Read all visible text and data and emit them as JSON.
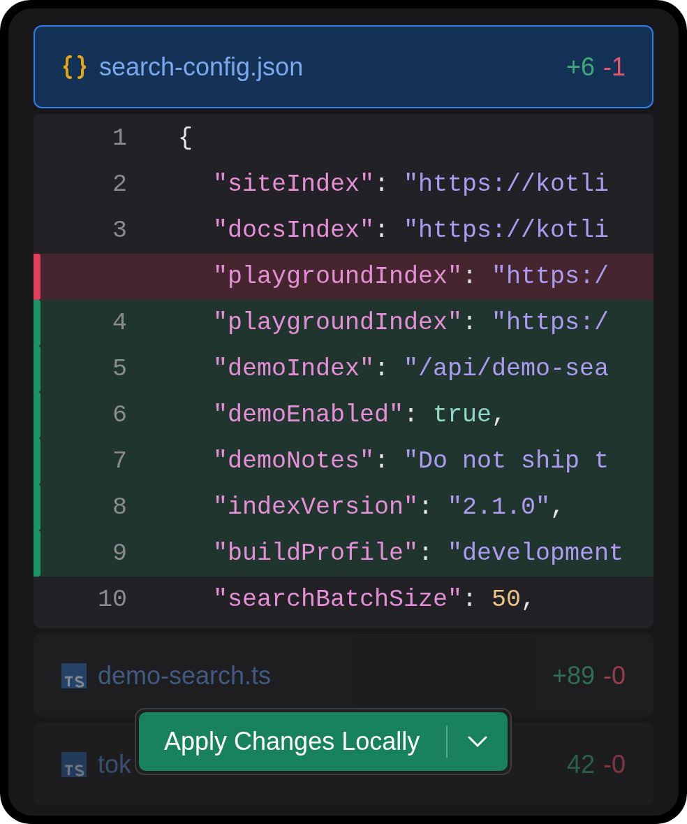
{
  "files": [
    {
      "name": "search-config.json",
      "kind": "json",
      "selected": true,
      "added": "+6",
      "removed": "-1",
      "lines": [
        {
          "number": "1",
          "kind": "context",
          "tokens": [
            {
              "kind": "punct",
              "text": "{"
            }
          ]
        },
        {
          "number": "2",
          "kind": "context",
          "tokens": [
            {
              "kind": "key",
              "text": "\"siteIndex\""
            },
            {
              "kind": "punct",
              "text": ": "
            },
            {
              "kind": "string",
              "text": "\"https://kotli"
            }
          ]
        },
        {
          "number": "3",
          "kind": "context",
          "tokens": [
            {
              "kind": "key",
              "text": "\"docsIndex\""
            },
            {
              "kind": "punct",
              "text": ": "
            },
            {
              "kind": "string",
              "text": "\"https://kotli"
            }
          ]
        },
        {
          "kind": "removed",
          "tokens": [
            {
              "kind": "key",
              "text": "\"playgroundIndex\""
            },
            {
              "kind": "punct",
              "text": ": "
            },
            {
              "kind": "string",
              "text": "\"https:/"
            }
          ]
        },
        {
          "number": "4",
          "kind": "added",
          "tokens": [
            {
              "kind": "key",
              "text": "\"playgroundIndex\""
            },
            {
              "kind": "punct",
              "text": ": "
            },
            {
              "kind": "string",
              "text": "\"https:/"
            }
          ]
        },
        {
          "number": "5",
          "kind": "added",
          "tokens": [
            {
              "kind": "key",
              "text": "\"demoIndex\""
            },
            {
              "kind": "punct",
              "text": ": "
            },
            {
              "kind": "string",
              "text": "\"/api/demo-sea"
            }
          ]
        },
        {
          "number": "6",
          "kind": "added",
          "tokens": [
            {
              "kind": "key",
              "text": "\"demoEnabled\""
            },
            {
              "kind": "punct",
              "text": ": "
            },
            {
              "kind": "bool",
              "text": "true"
            },
            {
              "kind": "punct",
              "text": ","
            }
          ]
        },
        {
          "number": "7",
          "kind": "added",
          "tokens": [
            {
              "kind": "key",
              "text": "\"demoNotes\""
            },
            {
              "kind": "punct",
              "text": ": "
            },
            {
              "kind": "string",
              "text": "\"Do not ship t"
            }
          ]
        },
        {
          "number": "8",
          "kind": "added",
          "tokens": [
            {
              "kind": "key",
              "text": "\"indexVersion\""
            },
            {
              "kind": "punct",
              "text": ": "
            },
            {
              "kind": "string",
              "text": "\"2.1.0\""
            },
            {
              "kind": "punct",
              "text": ","
            }
          ]
        },
        {
          "number": "9",
          "kind": "added",
          "tokens": [
            {
              "kind": "key",
              "text": "\"buildProfile\""
            },
            {
              "kind": "punct",
              "text": ": "
            },
            {
              "kind": "string",
              "text": "\"development"
            }
          ]
        },
        {
          "number": "10",
          "kind": "context",
          "tokens": [
            {
              "kind": "key",
              "text": "\"searchBatchSize\""
            },
            {
              "kind": "punct",
              "text": ": "
            },
            {
              "kind": "number",
              "text": "50"
            },
            {
              "kind": "punct",
              "text": ","
            }
          ]
        }
      ]
    },
    {
      "name": "demo-search.ts",
      "kind": "ts",
      "selected": false,
      "added": "+89",
      "removed": "-0"
    },
    {
      "name": "tok",
      "kind": "ts",
      "selected": false,
      "added": "42",
      "removed": "-0"
    }
  ],
  "apply_button": {
    "label": "Apply Changes Locally"
  }
}
